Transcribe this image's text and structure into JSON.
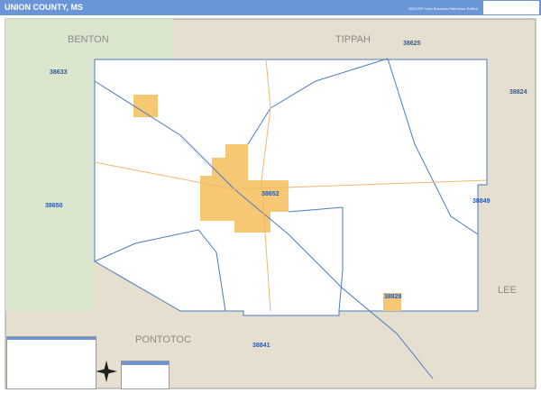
{
  "header": {
    "title": "UNION COUNTY, MS",
    "edition": "2020 ZIP Code Business Reference Edition"
  },
  "counties": [
    "BENTON",
    "TIPPAH",
    "LEE",
    "PONTOTOC"
  ],
  "zips": [
    "38633",
    "38625",
    "38824",
    "38650",
    "38652",
    "38849",
    "38828",
    "38841"
  ],
  "colors": {
    "header": "#6a96d8",
    "county": "#ffffff",
    "neighbor": "#e6dfcf",
    "forest": "#dbe6cf",
    "city": "#f7c873",
    "zip_line": "#4a7bc0"
  }
}
